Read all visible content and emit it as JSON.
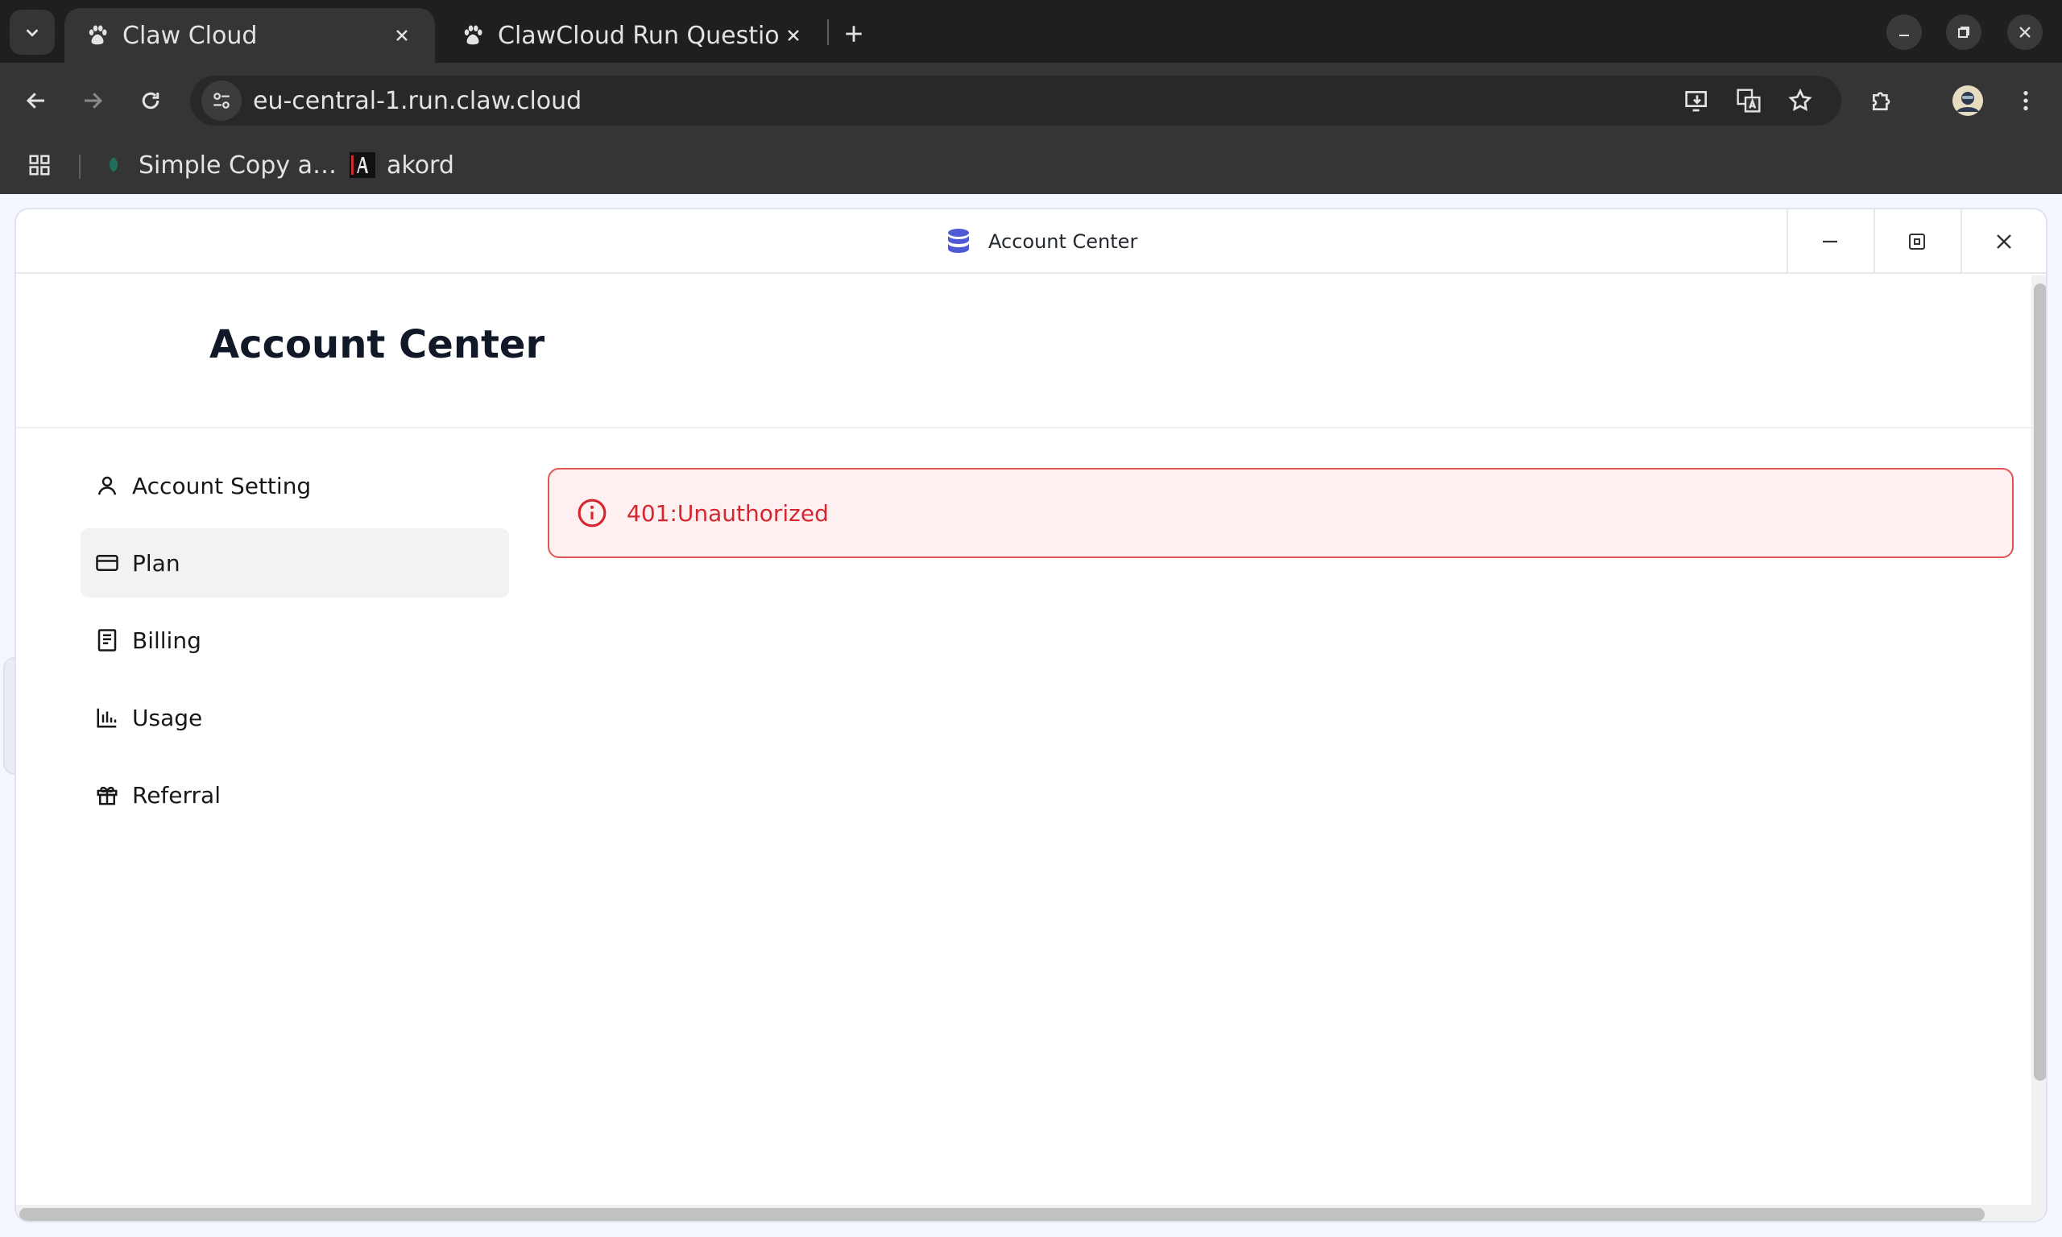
{
  "browser": {
    "tabs": [
      {
        "title": "Claw Cloud",
        "active": true,
        "icon": "paw-icon"
      },
      {
        "title": "ClawCloud Run Question",
        "active": false,
        "icon": "paw-icon"
      }
    ],
    "url": "eu-central-1.run.claw.cloud",
    "bookmarks": [
      {
        "label": "Simple Copy a…",
        "icon": "leaf-icon"
      },
      {
        "label": "akord",
        "icon": "akord-logo-icon"
      }
    ]
  },
  "app": {
    "window_title": "Account Center",
    "page_title": "Account Center",
    "sidebar": {
      "items": [
        {
          "label": "Account Setting",
          "icon": "user-icon",
          "active": false
        },
        {
          "label": "Plan",
          "icon": "credit-card-icon",
          "active": true
        },
        {
          "label": "Billing",
          "icon": "receipt-icon",
          "active": false
        },
        {
          "label": "Usage",
          "icon": "bar-chart-icon",
          "active": false
        },
        {
          "label": "Referral",
          "icon": "gift-icon",
          "active": false
        }
      ]
    },
    "alert": {
      "message": "401:Unauthorized",
      "color": "#d6262f",
      "icon": "info-circle-icon"
    }
  }
}
